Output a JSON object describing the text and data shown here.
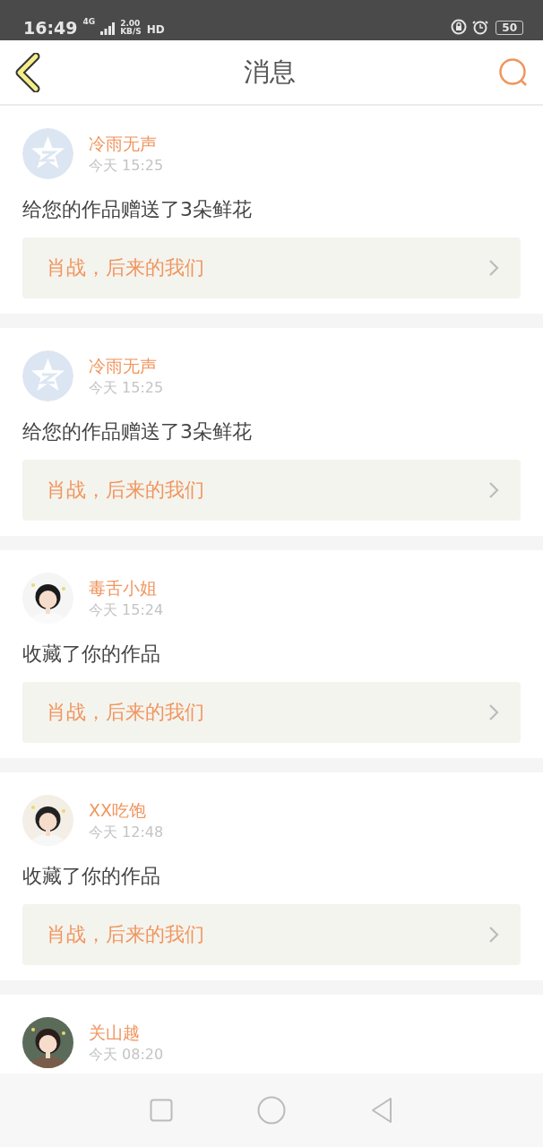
{
  "status_bar": {
    "time": "16:49",
    "network": "4G",
    "speed": "2.00",
    "speed_unit": "KB/S",
    "hd": "HD",
    "battery": "50"
  },
  "header": {
    "title": "消息"
  },
  "messages": [
    {
      "user": "冷雨无声",
      "avatar": {
        "kind": "default"
      },
      "time": "今天 15:25",
      "text": "给您的作品赠送了3朵鲜花",
      "work": "肖战，后来的我们"
    },
    {
      "user": "冷雨无声",
      "avatar": {
        "kind": "default"
      },
      "time": "今天 15:25",
      "text": "给您的作品赠送了3朵鲜花",
      "work": "肖战，后来的我们"
    },
    {
      "user": "毒舌小姐",
      "time": "今天 15:24",
      "text": "收藏了你的作品",
      "work": "肖战，后来的我们"
    },
    {
      "user": "XX吃饱",
      "time": "今天 12:48",
      "text": "收藏了你的作品",
      "work": "肖战，后来的我们"
    },
    {
      "user": "关山越",
      "time": "今天 08:20"
    }
  ]
}
